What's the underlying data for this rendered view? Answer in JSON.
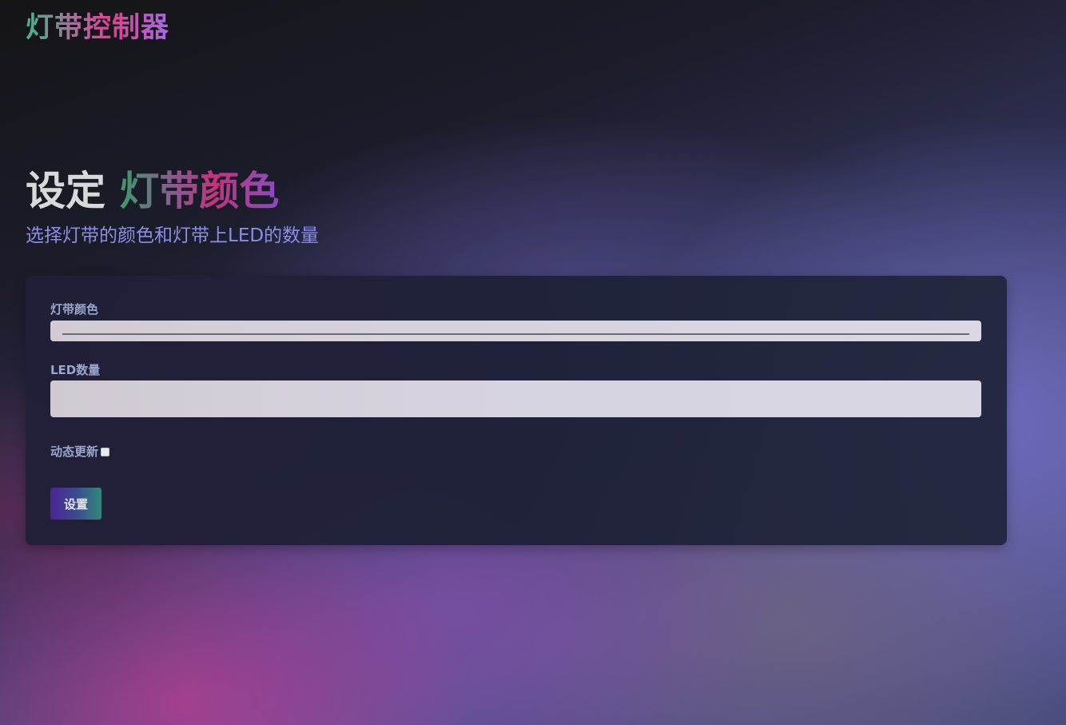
{
  "header": {
    "brand": "灯带控制器"
  },
  "hero": {
    "title_prefix": "设定 ",
    "title_accent": "灯带颜色",
    "subtitle": "选择灯带的颜色和灯带上LED的数量"
  },
  "form": {
    "color_label": "灯带颜色",
    "count_label": "LED数量",
    "count_value": "",
    "count_placeholder": "",
    "dynamic_label": "动态更新",
    "dynamic_checked": false,
    "submit_label": "设置"
  },
  "colors": {
    "brand_gradient": [
      "#46b48c",
      "#e0418f",
      "#a56be6"
    ],
    "subtitle": "#8d8de8",
    "label": "#9aa6cc",
    "card_background": "#1f2138",
    "button_gradient": [
      "#4a2596",
      "#2e8a7c"
    ]
  }
}
